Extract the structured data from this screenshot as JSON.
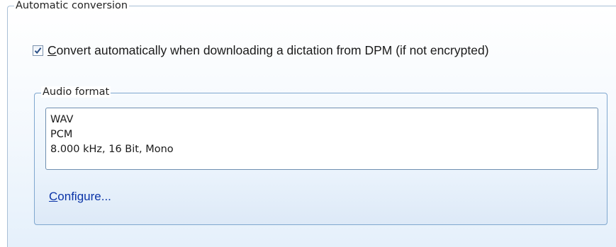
{
  "automatic_conversion": {
    "legend": "Automatic conversion",
    "checkbox": {
      "checked": true,
      "mnemonic": "C",
      "label_rest": "onvert automatically when downloading a dictation from DPM (if not encrypted)"
    },
    "audio_format": {
      "legend": "Audio format",
      "lines": [
        "WAV",
        "PCM",
        "8.000 kHz, 16 Bit, Mono"
      ],
      "configure": {
        "mnemonic": "C",
        "label_rest": "onfigure..."
      }
    }
  },
  "colors": {
    "link": "#0b34a8",
    "group_border": "#7fa7cf"
  }
}
